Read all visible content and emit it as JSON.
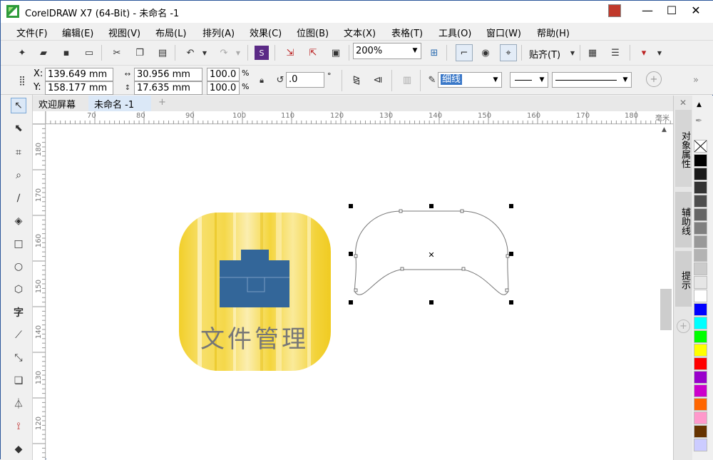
{
  "window": {
    "title": "CorelDRAW X7 (64-Bit) - 未命名 -1",
    "min": "—",
    "max": "☐",
    "close": "✕"
  },
  "menus": [
    "文件(F)",
    "编辑(E)",
    "视图(V)",
    "布局(L)",
    "排列(A)",
    "效果(C)",
    "位图(B)",
    "文本(X)",
    "表格(T)",
    "工具(O)",
    "窗口(W)",
    "帮助(H)"
  ],
  "toolbar": {
    "zoom": "200%",
    "snap_label": "贴齐(T)"
  },
  "props": {
    "x_label": "X:",
    "x_value": "139.649 mm",
    "y_label": "Y:",
    "y_value": "158.177 mm",
    "w_value": "30.956 mm",
    "h_value": "17.635 mm",
    "sx_value": "100.0",
    "sy_value": "100.0",
    "pct": "%",
    "angle_value": ".0",
    "deg": "°",
    "outline_width": "细线"
  },
  "doc_tabs": [
    "欢迎屏幕",
    "未命名 -1"
  ],
  "ruler_h": [
    "70",
    "80",
    "90",
    "100",
    "110",
    "120",
    "130",
    "140",
    "150",
    "160",
    "170",
    "180"
  ],
  "ruler_unit": "毫米",
  "ruler_v": [
    "180",
    "170",
    "160",
    "150",
    "140",
    "130",
    "120"
  ],
  "icon_caption": "文件管理",
  "dockers": [
    "对象属性",
    "辅助线",
    "提示"
  ],
  "palette_colors": [
    "#000000",
    "#1a1a1a",
    "#333333",
    "#4d4d4d",
    "#666666",
    "#808080",
    "#999999",
    "#b3b3b3",
    "#cccccc",
    "#e6e6e6",
    "#ffffff",
    "#0000ff",
    "#00ffff",
    "#00ff00",
    "#ffff00",
    "#ff0000",
    "#9900cc",
    "#cc00cc",
    "#ff6600",
    "#ff99cc",
    "#663300",
    "#ccccff"
  ]
}
